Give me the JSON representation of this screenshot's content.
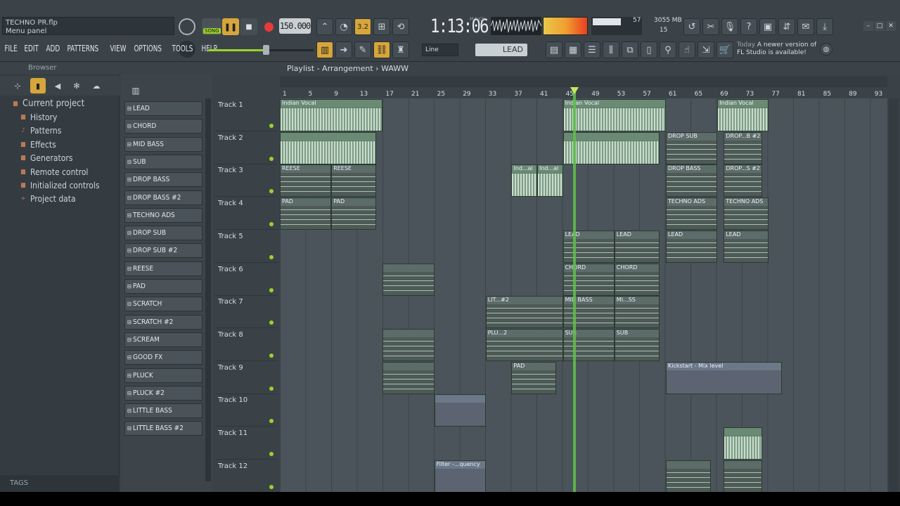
{
  "window": {
    "title": "TECHNO PR.flp",
    "hint": "Menu panel"
  },
  "menu": [
    "FILE",
    "EDIT",
    "ADD",
    "PATTERNS",
    "VIEW",
    "OPTIONS",
    "TOOLS",
    "HELP"
  ],
  "transport": {
    "song_label": "SONG",
    "tempo": "150.000",
    "time": "1:13:06",
    "time_unit": "M:S:CS",
    "cpu": "57",
    "memory": "3055 MB",
    "polyphony": "15"
  },
  "toolbar": {
    "snap": "Line",
    "pattern": "LEAD"
  },
  "news": {
    "when": "Today",
    "text": "A newer version of FL Studio is available!"
  },
  "browser": {
    "title": "Browser",
    "items": [
      {
        "label": "Current project",
        "icon": "folder-icon"
      },
      {
        "label": "History",
        "icon": "folder-icon"
      },
      {
        "label": "Patterns",
        "icon": "note-icon"
      },
      {
        "label": "Effects",
        "icon": "folder-icon"
      },
      {
        "label": "Generators",
        "icon": "folder-icon"
      },
      {
        "label": "Remote control",
        "icon": "folder-icon"
      },
      {
        "label": "Initialized controls",
        "icon": "folder-icon"
      },
      {
        "label": "Project data",
        "icon": "plus-icon"
      }
    ],
    "tags": "TAGS"
  },
  "patterns": [
    "LEAD",
    "CHORD",
    "MID BASS",
    "SUB",
    "DROP BASS",
    "DROP BASS #2",
    "TECHNO ADS",
    "DROP SUB",
    "DROP SUB #2",
    "REESE",
    "PAD",
    "SCRATCH",
    "SCRATCH #2",
    "SCREAM",
    "GOOD FX",
    "PLUCK",
    "PLUCK #2",
    "LITTLE BASS",
    "LITTLE BASS #2"
  ],
  "playlist": {
    "breadcrumb": "Playlist - Arrangement",
    "arrangement": "WAWW",
    "ruler": [
      "1",
      "5",
      "9",
      "13",
      "17",
      "21",
      "25",
      "29",
      "33",
      "37",
      "41",
      "45",
      "49",
      "53",
      "57",
      "61",
      "65",
      "69",
      "73",
      "77",
      "81",
      "85",
      "89",
      "93"
    ],
    "tracks": [
      "Track 1",
      "Track 2",
      "Track 3",
      "Track 4",
      "Track 5",
      "Track 6",
      "Track 7",
      "Track 8",
      "Track 9",
      "Track 10",
      "Track 11",
      "Track 12"
    ],
    "clips": [
      {
        "track": 0,
        "start": 1,
        "len": 16,
        "type": "aud",
        "label": "Indian Vocal"
      },
      {
        "track": 0,
        "start": 45,
        "len": 16,
        "type": "aud",
        "label": "Indian Vocal"
      },
      {
        "track": 0,
        "start": 69,
        "len": 8,
        "type": "aud",
        "label": "Indian Vocal"
      },
      {
        "track": 1,
        "start": 1,
        "len": 15,
        "type": "aud",
        "label": ""
      },
      {
        "track": 1,
        "start": 45,
        "len": 15,
        "type": "aud",
        "label": ""
      },
      {
        "track": 1,
        "start": 61,
        "len": 8,
        "type": "pat",
        "label": "DROP SUB"
      },
      {
        "track": 1,
        "start": 70,
        "len": 6,
        "type": "pat",
        "label": "DROP...B #2"
      },
      {
        "track": 2,
        "start": 1,
        "len": 8,
        "type": "pat",
        "label": "REESE"
      },
      {
        "track": 2,
        "start": 9,
        "len": 7,
        "type": "pat",
        "label": "REESE"
      },
      {
        "track": 2,
        "start": 37,
        "len": 4,
        "type": "aud",
        "label": "Ind...al"
      },
      {
        "track": 2,
        "start": 41,
        "len": 4,
        "type": "aud",
        "label": "Ind...al"
      },
      {
        "track": 2,
        "start": 61,
        "len": 8,
        "type": "pat",
        "label": "DROP BASS"
      },
      {
        "track": 2,
        "start": 70,
        "len": 6,
        "type": "pat",
        "label": "DROP...S #2"
      },
      {
        "track": 3,
        "start": 1,
        "len": 8,
        "type": "pat",
        "label": "PAD"
      },
      {
        "track": 3,
        "start": 9,
        "len": 7,
        "type": "pat",
        "label": "PAD"
      },
      {
        "track": 3,
        "start": 61,
        "len": 8,
        "type": "pat",
        "label": "TECHNO ADS"
      },
      {
        "track": 3,
        "start": 70,
        "len": 7,
        "type": "pat",
        "label": "TECHNO ADS"
      },
      {
        "track": 4,
        "start": 45,
        "len": 8,
        "type": "pat",
        "label": "LEAD"
      },
      {
        "track": 4,
        "start": 53,
        "len": 7,
        "type": "pat",
        "label": "LEAD"
      },
      {
        "track": 4,
        "start": 61,
        "len": 8,
        "type": "pat",
        "label": "LEAD"
      },
      {
        "track": 4,
        "start": 70,
        "len": 7,
        "type": "pat",
        "label": "LEAD"
      },
      {
        "track": 5,
        "start": 17,
        "len": 8,
        "type": "pat",
        "label": ""
      },
      {
        "track": 5,
        "start": 45,
        "len": 8,
        "type": "pat",
        "label": "CHORD"
      },
      {
        "track": 5,
        "start": 53,
        "len": 7,
        "type": "pat",
        "label": "CHORD"
      },
      {
        "track": 6,
        "start": 33,
        "len": 12,
        "type": "pat",
        "label": "LIT...#2"
      },
      {
        "track": 6,
        "start": 45,
        "len": 8,
        "type": "pat",
        "label": "MID BASS"
      },
      {
        "track": 6,
        "start": 53,
        "len": 7,
        "type": "pat",
        "label": "MI...SS"
      },
      {
        "track": 7,
        "start": 17,
        "len": 8,
        "type": "pat",
        "label": ""
      },
      {
        "track": 7,
        "start": 33,
        "len": 12,
        "type": "pat",
        "label": "PLU...2"
      },
      {
        "track": 7,
        "start": 45,
        "len": 8,
        "type": "pat",
        "label": "SUB"
      },
      {
        "track": 7,
        "start": 53,
        "len": 7,
        "type": "pat",
        "label": "SUB"
      },
      {
        "track": 8,
        "start": 17,
        "len": 8,
        "type": "pat",
        "label": ""
      },
      {
        "track": 8,
        "start": 37,
        "len": 7,
        "type": "pat",
        "label": "PAD"
      },
      {
        "track": 8,
        "start": 61,
        "len": 18,
        "type": "auto",
        "label": "Kickstart - Mix level"
      },
      {
        "track": 9,
        "start": 25,
        "len": 8,
        "type": "auto",
        "label": ""
      },
      {
        "track": 10,
        "start": 70,
        "len": 6,
        "type": "aud",
        "label": ""
      },
      {
        "track": 11,
        "start": 25,
        "len": 8,
        "type": "auto",
        "label": "Filter -...quency"
      },
      {
        "track": 11,
        "start": 61,
        "len": 7,
        "type": "pat",
        "label": ""
      },
      {
        "track": 11,
        "start": 70,
        "len": 6,
        "type": "pat",
        "label": ""
      }
    ]
  },
  "colors": {
    "accent": "#9bd22b",
    "playhead": "#5ebc4a",
    "record": "#e83a3a"
  }
}
